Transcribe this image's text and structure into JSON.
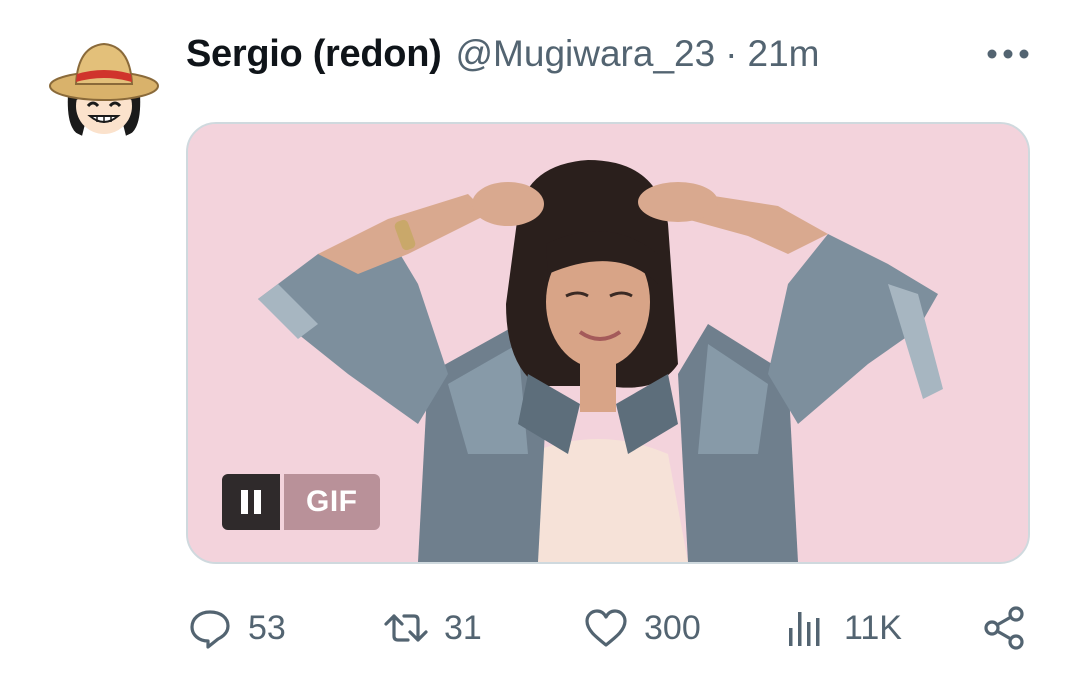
{
  "tweet": {
    "author_name": "Sergio (redon)",
    "handle": "@Mugiwara_23",
    "separator": "·",
    "time": "21m",
    "avatar_icon": "straw-hat-avatar",
    "more_icon": "more-dots-icon"
  },
  "media": {
    "gif_label": "GIF",
    "pause_icon": "pause-icon",
    "background_color": "#f3d3dc"
  },
  "actions": {
    "reply_count": "53",
    "retweet_count": "31",
    "like_count": "300",
    "views_count": "11K",
    "reply_icon": "reply-icon",
    "retweet_icon": "retweet-icon",
    "like_icon": "heart-icon",
    "views_icon": "views-icon",
    "share_icon": "share-icon"
  },
  "colors": {
    "text_primary": "#0f1419",
    "text_secondary": "#536471",
    "border": "#cfd9de"
  }
}
